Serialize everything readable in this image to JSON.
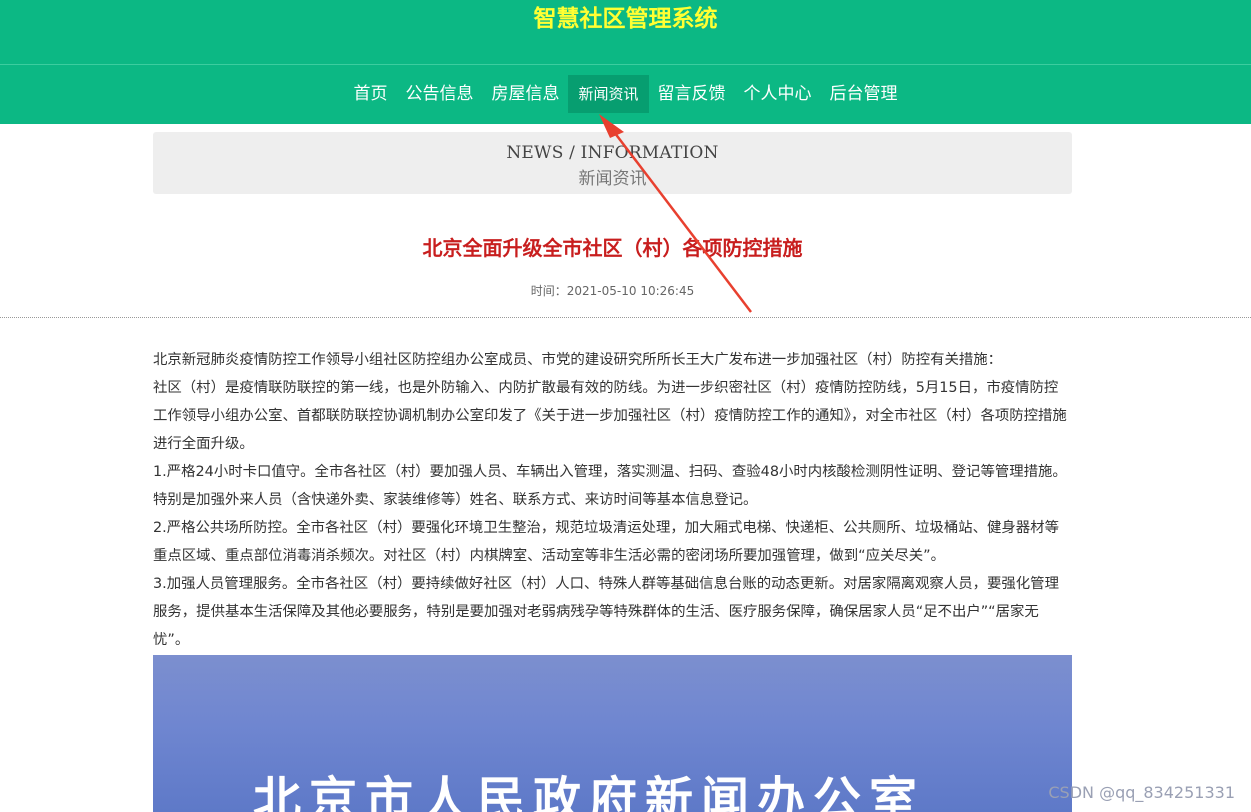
{
  "header": {
    "title": "智慧社区管理系统",
    "nav": [
      "首页",
      "公告信息",
      "房屋信息",
      "新闻资讯",
      "留言反馈",
      "个人中心",
      "后台管理"
    ],
    "active_index": 3
  },
  "banner": {
    "en": "NEWS / INFORMATION",
    "cn": "新闻资讯"
  },
  "article": {
    "title": "北京全面升级全市社区（村）各项防控措施",
    "time": "时间：2021-05-10 10:26:45",
    "paragraphs": [
      "北京新冠肺炎疫情防控工作领导小组社区防控组办公室成员、市党的建设研究所所长王大广发布进一步加强社区（村）防控有关措施：",
      "社区（村）是疫情联防联控的第一线，也是外防输入、内防扩散最有效的防线。为进一步织密社区（村）疫情防控防线，5月15日，市疫情防控工作领导小组办公室、首都联防联控协调机制办公室印发了《关于进一步加强社区（村）疫情防控工作的通知》，对全市社区（村）各项防控措施进行全面升级。",
      "1.严格24小时卡口值守。全市各社区（村）要加强人员、车辆出入管理，落实测温、扫码、查验48小时内核酸检测阴性证明、登记等管理措施。特别是加强外来人员（含快递外卖、家装维修等）姓名、联系方式、来访时间等基本信息登记。",
      "2.严格公共场所防控。全市各社区（村）要强化环境卫生整治，规范垃圾清运处理，加大厢式电梯、快递柜、公共厕所、垃圾桶站、健身器材等重点区域、重点部位消毒消杀频次。对社区（村）内棋牌室、活动室等非生活必需的密闭场所要加强管理，做到“应关尽关”。",
      "3.加强人员管理服务。全市各社区（村）要持续做好社区（村）人口、特殊人群等基础信息台账的动态更新。对居家隔离观察人员，要强化管理服务，提供基本生活保障及其他必要服务，特别是要加强对老弱病残孕等特殊群体的生活、医疗服务保障，确保居家人员“足不出户”“居家无忧”。"
    ],
    "image_text": "北京市人民政府新闻办公室"
  },
  "watermark": "CSDN @qq_834251331",
  "colors": {
    "header_bg": "#0cb884",
    "title": "#ffff33",
    "nav_active_bg": "#079e70",
    "article_title": "#c81e1e",
    "annotation_arrow": "#e8402f"
  }
}
